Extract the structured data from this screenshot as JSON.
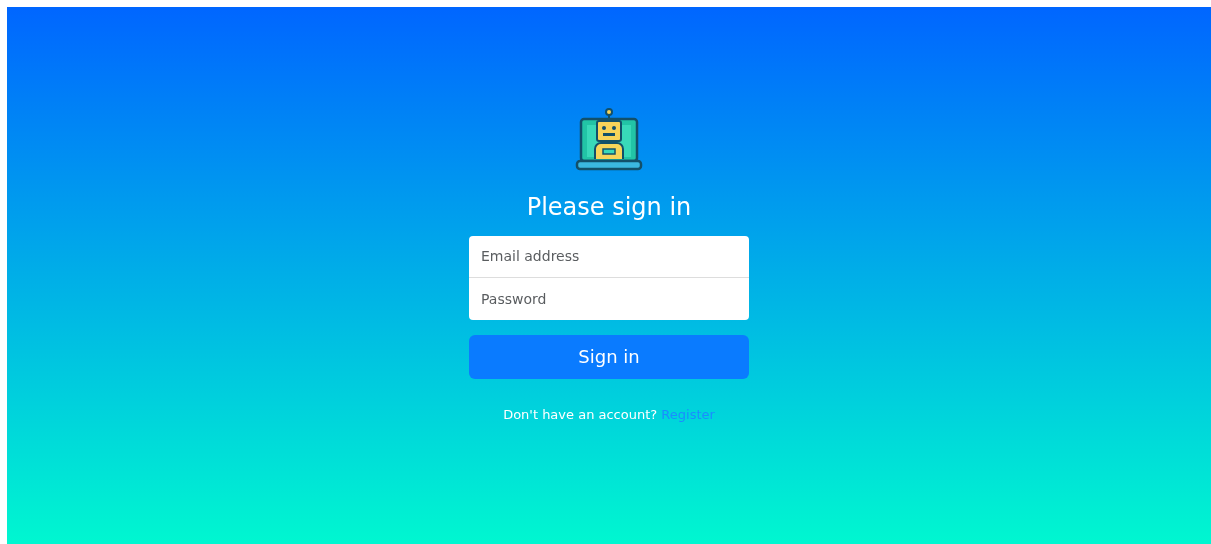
{
  "heading": "Please sign in",
  "fields": [
    {
      "placeholder": "Email address"
    },
    {
      "placeholder": "Password"
    }
  ],
  "submit": "Sign in",
  "footer": {
    "text": "Don't have an account?",
    "link": "Register"
  }
}
